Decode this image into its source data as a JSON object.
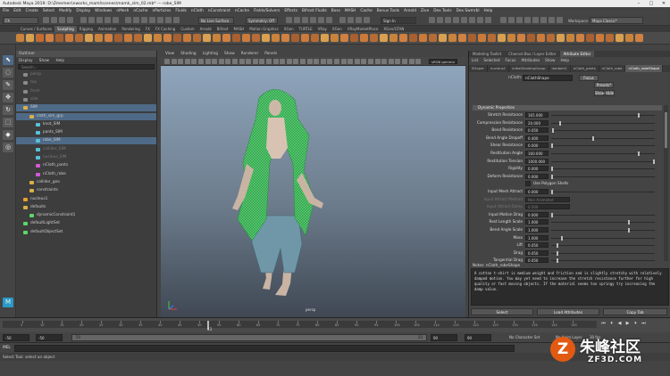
{
  "window": {
    "title": "Autodesk Maya 2019: D:\\Zmemen\\nworks_maml\\scenes\\mamk_slm_02.mb*  ---  robe_SIM"
  },
  "menubar": [
    "File",
    "Edit",
    "Create",
    "Select",
    "Modify",
    "Display",
    "Windows",
    "nMesh",
    "nCache",
    "nParticles",
    "Fluids",
    "nCloth",
    "nConstraint",
    "nCache",
    "Fields/Solvers",
    "Effects",
    "Bifrost Fluids",
    "Boss",
    "MASH",
    "Cache",
    "Bonus Tools",
    "Arnold",
    "Zive",
    "Dex Tools",
    "Dex Swmrbl",
    "Help"
  ],
  "statusline": {
    "mode": "FX",
    "no_live_surface": "No Live Surface",
    "symmetry": "Symmetry: Off",
    "sign_in": "Sign In",
    "workspace_label": "Workspace:",
    "workspace": "Maya Classic*"
  },
  "shelf_tabs": [
    "Curves / Surfaces",
    "Sculpting",
    "Rigging",
    "Animation",
    "Rendering",
    "FX",
    "FX Caching",
    "Custom",
    "Arnold",
    "Bifrost",
    "MASH",
    "Motion Graphics",
    "XGen",
    "TURTLE",
    "VRay",
    "XGen",
    "VRayMarketPlace",
    "XGen/GTAN"
  ],
  "shelf_active": "Sculpting",
  "shelf_icon_colors": [
    "#c9833a",
    "#d9a050",
    "#c56b30",
    "#d08040",
    "#a86030",
    "#cc7a3a",
    "#b66c34",
    "#d9a050",
    "#c9833a",
    "#d08040",
    "#a86030",
    "#cc7a3a",
    "#b66c34",
    "#d9a050",
    "#c9833a",
    "#d08040",
    "#a86030",
    "#cc7a3a",
    "#b66c34",
    "#d9a050",
    "#c9833a",
    "#d08040",
    "#a86030",
    "#cc7a3a",
    "#b66c34",
    "#d9a050",
    "#c9833a",
    "#d08040",
    "#a86030",
    "#cc7a3a",
    "#b66c34",
    "#d9a050",
    "#c9833a",
    "#d08040",
    "#a86030",
    "#cc7a3a",
    "#b66c34",
    "#d9a050",
    "#c9833a",
    "#d08040",
    "#a86030",
    "#cc7a3a",
    "#b66c34",
    "#d9a050",
    "#c9833a",
    "#d08040",
    "#a86030",
    "#cc7a3a",
    "#b66c34",
    "#d9a050",
    "#c9833a",
    "#d08040",
    "#a86030",
    "#cc7a3a",
    "#b66c34",
    "#d9a050",
    "#c9833a",
    "#d08040",
    "#a86030",
    "#cc7a3a",
    "#b66c34",
    "#d9a050",
    "#c9833a",
    "#d08040"
  ],
  "toolbox": [
    "select-tool-icon",
    "lasso-tool-icon",
    "paint-select-icon",
    "move-tool-icon",
    "rotate-tool-icon",
    "scale-tool-icon",
    "last-tool-icon",
    "soft-select-icon"
  ],
  "outliner": {
    "title": "Outliner",
    "menu": [
      "Display",
      "Show",
      "Help"
    ],
    "search_placeholder": "Search...",
    "items": [
      {
        "label": "persp",
        "type": "camera",
        "indent": 0,
        "selected": false,
        "dim": true
      },
      {
        "label": "top",
        "type": "camera",
        "indent": 0,
        "selected": false,
        "dim": true
      },
      {
        "label": "front",
        "type": "camera",
        "indent": 0,
        "selected": false,
        "dim": true
      },
      {
        "label": "side",
        "type": "camera",
        "indent": 0,
        "selected": false,
        "dim": true
      },
      {
        "label": "SIM",
        "type": "group",
        "indent": 0,
        "selected": true,
        "dim": false
      },
      {
        "label": "cloth_sim_grp",
        "type": "group",
        "indent": 1,
        "selected": true,
        "dim": false
      },
      {
        "label": "knot_SIM",
        "type": "mesh",
        "indent": 2,
        "selected": false,
        "dim": false
      },
      {
        "label": "pants_SIM",
        "type": "mesh",
        "indent": 2,
        "selected": false,
        "dim": false
      },
      {
        "label": "robe_SIM",
        "type": "mesh",
        "indent": 2,
        "selected": true,
        "dim": false
      },
      {
        "label": "collider_SIM",
        "type": "mesh",
        "indent": 2,
        "selected": false,
        "dim": true
      },
      {
        "label": "nucleus_SIM",
        "type": "mesh",
        "indent": 2,
        "selected": false,
        "dim": true
      },
      {
        "label": "nCloth_pants",
        "type": "ncloth",
        "indent": 2,
        "selected": false,
        "dim": false
      },
      {
        "label": "nCloth_robe",
        "type": "ncloth",
        "indent": 2,
        "selected": false,
        "dim": false
      },
      {
        "label": "collider_geo",
        "type": "group",
        "indent": 1,
        "selected": false,
        "dim": false
      },
      {
        "label": "constraints",
        "type": "group",
        "indent": 1,
        "selected": false,
        "dim": false
      },
      {
        "label": "nucleus1",
        "type": "nucleus",
        "indent": 0,
        "selected": false,
        "dim": false
      },
      {
        "label": "defaults",
        "type": "group",
        "indent": 0,
        "selected": false,
        "dim": false
      },
      {
        "label": "dynamicConstraint1",
        "type": "set",
        "indent": 1,
        "selected": false,
        "dim": false
      },
      {
        "label": "defaultLightSet",
        "type": "set",
        "indent": 0,
        "selected": false,
        "dim": false
      },
      {
        "label": "defaultObjectSet",
        "type": "set",
        "indent": 0,
        "selected": false,
        "dim": false
      }
    ]
  },
  "viewport": {
    "menu": [
      "View",
      "Shading",
      "Lighting",
      "Show",
      "Renderer",
      "Panels"
    ],
    "camera_label": "persp",
    "gamma": "sRGB gamma"
  },
  "right_panel": {
    "tabs": [
      "Modeling Toolkit",
      "Channel Box / Layer Editor",
      "Attribute Editor"
    ],
    "active_tab": "Attribute Editor",
    "menu": [
      "List",
      "Selected",
      "Focus",
      "Attributes",
      "Show",
      "Help"
    ],
    "node_tabs": [
      "SGeper",
      "nucleus1",
      "initialShadingGroup",
      "lambert1",
      "nCloth_pants",
      "nCloth_robe",
      "nCloth_robeShape"
    ],
    "active_node_tab": "nCloth_robeShape",
    "node_label": "nCloth:",
    "node_value": "nClothShape",
    "focus_button": "Focus",
    "presets_button": "Presets*",
    "show_button": "Show",
    "hide_button": "Hide",
    "section": "Dynamic Properties",
    "attributes": [
      {
        "label": "Stretch Resistance",
        "value": "165.000",
        "frac": 0.85
      },
      {
        "label": "Compression Resistance",
        "value": "20.000",
        "frac": 0.08
      },
      {
        "label": "Bend Resistance",
        "value": "0.050",
        "frac": 0.01
      },
      {
        "label": "Bend Angle Dropoff",
        "value": "0.400",
        "frac": 0.4
      },
      {
        "label": "Shear Resistance",
        "value": "0.000",
        "frac": 0.0
      },
      {
        "label": "Restitution Angle",
        "value": "160.000",
        "frac": 0.85
      },
      {
        "label": "Restitution Tension",
        "value": "1000.000",
        "frac": 1.0
      },
      {
        "label": "Rigidity",
        "value": "0.000",
        "frac": 0.0
      },
      {
        "label": "Deform Resistance",
        "value": "0.000",
        "frac": 0.0
      },
      {
        "label": "",
        "value": "",
        "frac": 0,
        "checkbox": "Use Polygon Shells"
      },
      {
        "label": "Input Mesh Attract",
        "value": "0.000",
        "frac": 0.0
      },
      {
        "label": "Input Attract Method",
        "value": "Non Animated",
        "frac": 0,
        "dim": true
      },
      {
        "label": "Input Attract Damp",
        "value": "0.500",
        "frac": 0,
        "dim": true
      },
      {
        "label": "Input Motion Drag",
        "value": "0.000",
        "frac": 0.0
      },
      {
        "label": "Rest Length Scale",
        "value": "1.000",
        "frac": 0.75
      },
      {
        "label": "Bend Angle Scale",
        "value": "1.000",
        "frac": 0.75
      },
      {
        "label": "Mass",
        "value": "1.000",
        "frac": 0.1
      },
      {
        "label": "Lift",
        "value": "0.050",
        "frac": 0.05
      },
      {
        "label": "Drag",
        "value": "0.050",
        "frac": 0.05
      },
      {
        "label": "Tangential Drag",
        "value": "0.050",
        "frac": 0.05
      }
    ],
    "notes_label": "Notes: nCloth_robeShape",
    "notes": "A cotton t-shirt is medium weight and friction and is slightly stretchy with relatively damped motion. You may yet need to increase the stretch resistance further for high quality or fast moving objects. If the material seems too springy try increasing the damp value.",
    "buttons": [
      "Select",
      "Load Attributes",
      "Copy Tab"
    ]
  },
  "timeline": {
    "ticks": [
      "5",
      "10",
      "15",
      "20",
      "25",
      "30",
      "35",
      "40",
      "45",
      "50",
      "55",
      "60",
      "65",
      "70",
      "75",
      "80",
      "85",
      "90",
      "95",
      "100",
      "105",
      "110",
      "115",
      "120",
      "125",
      "130",
      "135",
      "140",
      "145"
    ],
    "current_frame": "43",
    "current_frac": 0.345
  },
  "range": {
    "start": "-50",
    "start2": "-50",
    "min": "50",
    "end": "90",
    "end2": "90",
    "end_label": "50",
    "character_set": "No Character Set",
    "anim_layer": "No Anim Layer",
    "fps": "30 fps"
  },
  "mel_label": "MEL",
  "help_line": "Select Tool: select an object",
  "watermark": {
    "big": "朱峰社区",
    "small": "ZF3D.COM",
    "logo": "Z"
  }
}
